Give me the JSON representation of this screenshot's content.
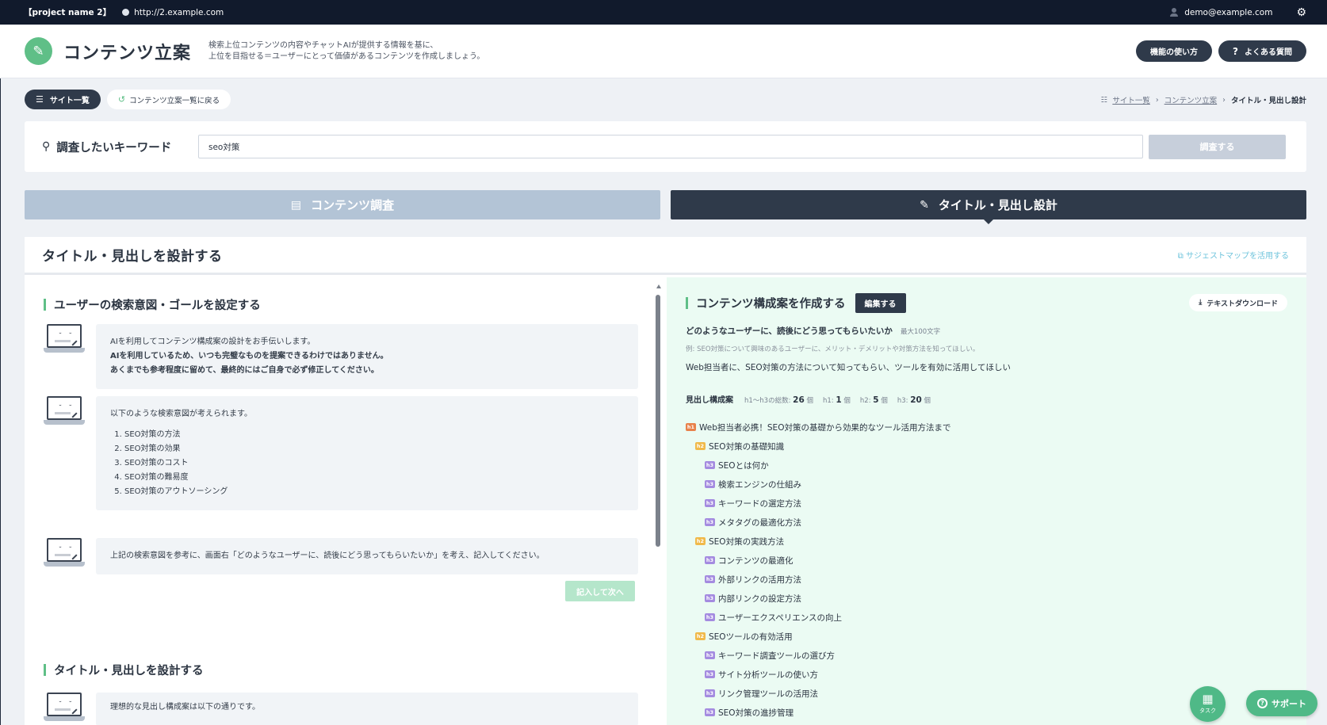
{
  "topbar": {
    "project": "【project name 2】",
    "url": "http://2.example.com",
    "email": "demo@example.com",
    "gear_icon": "⚙"
  },
  "header": {
    "title": "コンテンツ立案",
    "desc_line1": "検索上位コンテンツの内容やチャットAIが提供する情報を基に、",
    "desc_line2": "上位を目指せる＝ユーザーにとって価値があるコンテンツを作成しましょう。",
    "howto_label": "機能の使い方",
    "faq_label": "よくある質問",
    "faq_icon": "?",
    "logo_icon": "✎"
  },
  "subnav": {
    "sites_label": "サイト一覧",
    "back_label": "コンテンツ立案一覧に戻る",
    "sites_icon": "☰",
    "back_icon": "↺"
  },
  "breadcrumb": {
    "icon": "☷",
    "item1": "サイト一覧",
    "item2": "コンテンツ立案",
    "current": "タイトル・見出し設計",
    "sep": "›"
  },
  "keyword": {
    "label": "調査したいキーワード",
    "value": "seo対策",
    "button": "調査する",
    "search_icon": "⚲"
  },
  "tabs": {
    "research": "コンテンツ調査",
    "design": "タイトル・見出し設計",
    "research_icon": "▤",
    "design_icon": "✎"
  },
  "panel": {
    "title": "タイトル・見出しを設計する",
    "suggest_link": "サジェストマップを活用する",
    "suggest_icon": "⧉"
  },
  "left": {
    "section1_title": "ユーザーの検索意図・ゴールを設定する",
    "bubble1_line1": "AIを利用してコンテンツ構成案の設計をお手伝いします。",
    "bubble1_line2": "AIを利用しているため、いつも完璧なものを提案できるわけではありません。",
    "bubble1_line3": "あくまでも参考程度に留めて、最終的にはご自身で必ず修正してください。",
    "bubble2_intro": "以下のような検索意図が考えられます。",
    "intents": [
      "SEO対策の方法",
      "SEO対策の効果",
      "SEO対策のコスト",
      "SEO対策の難易度",
      "SEO対策のアウトソーシング"
    ],
    "bubble3": "上記の検索意図を参考に、画面右「どのようなユーザーに、読後にどう思ってもらいたいか」を考え、記入してください。",
    "next_button": "記入して次へ",
    "section2_title": "タイトル・見出しを設計する",
    "bubble4": "理想的な見出し構成案は以下の通りです。",
    "face_eyes": "˘ ˘"
  },
  "right": {
    "section_title": "コンテンツ構成案を作成する",
    "edit_button": "編集する",
    "download_label": "テキストダウンロード",
    "download_icon": "⤓",
    "question": "どのようなユーザーに、読後にどう思ってもらいたいか",
    "max_chars": "最大100文字",
    "example": "例: SEO対策について興味のあるユーザーに、メリット・デメリットや対策方法を知ってほしい。",
    "answer": "Web担当者に、SEO対策の方法について知ってもらい、ツールを有効に活用してほしい",
    "outline_title": "見出し構成案",
    "total_label": "h1〜h3の総数:",
    "total": "26",
    "h1_label": "h1:",
    "h1_count": "1",
    "h2_label": "h2:",
    "h2_count": "5",
    "h3_label": "h3:",
    "h3_count": "20",
    "unit": "個",
    "outline": [
      {
        "level": "h1",
        "text": "Web担当者必携！SEO対策の基礎から効果的なツール活用方法まで"
      },
      {
        "level": "h2",
        "text": "SEO対策の基礎知識"
      },
      {
        "level": "h3",
        "text": "SEOとは何か"
      },
      {
        "level": "h3",
        "text": "検索エンジンの仕組み"
      },
      {
        "level": "h3",
        "text": "キーワードの選定方法"
      },
      {
        "level": "h3",
        "text": "メタタグの最適化方法"
      },
      {
        "level": "h2",
        "text": "SEO対策の実践方法"
      },
      {
        "level": "h3",
        "text": "コンテンツの最適化"
      },
      {
        "level": "h3",
        "text": "外部リンクの活用方法"
      },
      {
        "level": "h3",
        "text": "内部リンクの設定方法"
      },
      {
        "level": "h3",
        "text": "ユーザーエクスペリエンスの向上"
      },
      {
        "level": "h2",
        "text": "SEOツールの有効活用"
      },
      {
        "level": "h3",
        "text": "キーワード調査ツールの選び方"
      },
      {
        "level": "h3",
        "text": "サイト分析ツールの使い方"
      },
      {
        "level": "h3",
        "text": "リンク管理ツールの活用法"
      },
      {
        "level": "h3",
        "text": "SEO対策の進捗管理"
      }
    ]
  },
  "fab": {
    "task_label": "タスク",
    "task_icon": "▦",
    "support_label": "サポート",
    "support_icon": "?"
  }
}
